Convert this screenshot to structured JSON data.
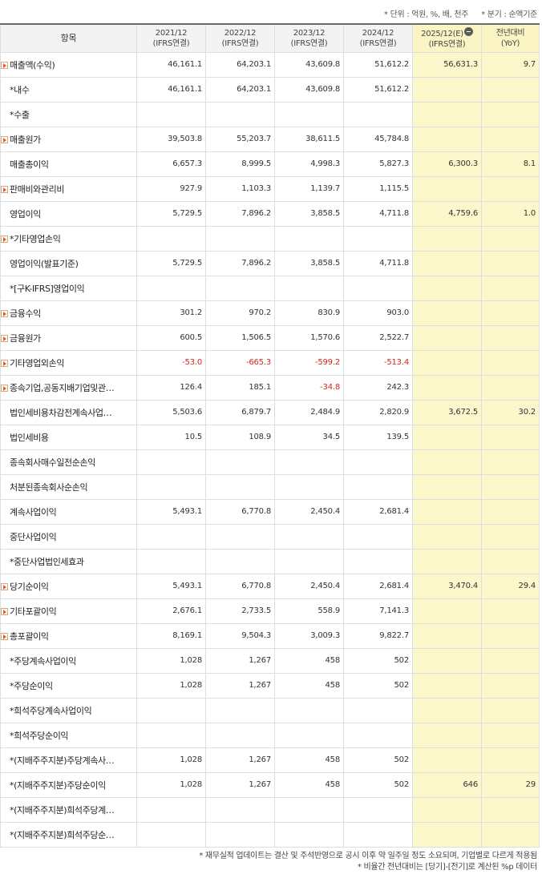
{
  "top_note": {
    "unit": "* 단위 : 억원, %, 배, 천주",
    "period": "* 분기 : 순액기준"
  },
  "headers": {
    "item": "항목",
    "columns": [
      {
        "year": "2021/12",
        "basis": "(IFRS연결)"
      },
      {
        "year": "2022/12",
        "basis": "(IFRS연결)"
      },
      {
        "year": "2023/12",
        "basis": "(IFRS연결)"
      },
      {
        "year": "2024/12",
        "basis": "(IFRS연결)"
      },
      {
        "year": "2025/12(E)",
        "basis": "(IFRS연결)"
      },
      {
        "year": "전년대비",
        "basis": "(YoY)"
      }
    ]
  },
  "rows": [
    {
      "label": "매출액(수익)",
      "expand": true,
      "values": [
        "46,161.1",
        "64,203.1",
        "43,609.8",
        "51,612.2",
        "56,631.3",
        "9.7"
      ]
    },
    {
      "label": "*내수",
      "expand": false,
      "values": [
        "46,161.1",
        "64,203.1",
        "43,609.8",
        "51,612.2",
        "",
        ""
      ]
    },
    {
      "label": "*수출",
      "expand": false,
      "values": [
        "",
        "",
        "",
        "",
        "",
        ""
      ]
    },
    {
      "label": "매출원가",
      "expand": true,
      "values": [
        "39,503.8",
        "55,203.7",
        "38,611.5",
        "45,784.8",
        "",
        ""
      ]
    },
    {
      "label": "매출총이익",
      "expand": false,
      "values": [
        "6,657.3",
        "8,999.5",
        "4,998.3",
        "5,827.3",
        "6,300.3",
        "8.1"
      ]
    },
    {
      "label": "판매비와관리비",
      "expand": true,
      "values": [
        "927.9",
        "1,103.3",
        "1,139.7",
        "1,115.5",
        "",
        ""
      ]
    },
    {
      "label": "영업이익",
      "expand": false,
      "values": [
        "5,729.5",
        "7,896.2",
        "3,858.5",
        "4,711.8",
        "4,759.6",
        "1.0"
      ]
    },
    {
      "label": "*기타영업손익",
      "expand": true,
      "values": [
        "",
        "",
        "",
        "",
        "",
        ""
      ]
    },
    {
      "label": "영업이익(발표기준)",
      "expand": false,
      "values": [
        "5,729.5",
        "7,896.2",
        "3,858.5",
        "4,711.8",
        "",
        ""
      ]
    },
    {
      "label": "*[구K-IFRS]영업이익",
      "expand": false,
      "values": [
        "",
        "",
        "",
        "",
        "",
        ""
      ]
    },
    {
      "label": "금융수익",
      "expand": true,
      "values": [
        "301.2",
        "970.2",
        "830.9",
        "903.0",
        "",
        ""
      ]
    },
    {
      "label": "금융원가",
      "expand": true,
      "values": [
        "600.5",
        "1,506.5",
        "1,570.6",
        "2,522.7",
        "",
        ""
      ]
    },
    {
      "label": "기타영업외손익",
      "expand": true,
      "values": [
        "-53.0",
        "-665.3",
        "-599.2",
        "-513.4",
        "",
        ""
      ]
    },
    {
      "label": "종속기업,공동지배기업및관…",
      "expand": true,
      "values": [
        "126.4",
        "185.1",
        "-34.8",
        "242.3",
        "",
        ""
      ]
    },
    {
      "label": "법인세비용차감전계속사업…",
      "expand": false,
      "values": [
        "5,503.6",
        "6,879.7",
        "2,484.9",
        "2,820.9",
        "3,672.5",
        "30.2"
      ]
    },
    {
      "label": "법인세비용",
      "expand": false,
      "values": [
        "10.5",
        "108.9",
        "34.5",
        "139.5",
        "",
        ""
      ]
    },
    {
      "label": "종속회사매수일전순손익",
      "expand": false,
      "values": [
        "",
        "",
        "",
        "",
        "",
        ""
      ]
    },
    {
      "label": "처분된종속회사순손익",
      "expand": false,
      "values": [
        "",
        "",
        "",
        "",
        "",
        ""
      ]
    },
    {
      "label": "계속사업이익",
      "expand": false,
      "values": [
        "5,493.1",
        "6,770.8",
        "2,450.4",
        "2,681.4",
        "",
        ""
      ]
    },
    {
      "label": "중단사업이익",
      "expand": false,
      "values": [
        "",
        "",
        "",
        "",
        "",
        ""
      ]
    },
    {
      "label": "*중단사업법인세효과",
      "expand": false,
      "values": [
        "",
        "",
        "",
        "",
        "",
        ""
      ]
    },
    {
      "label": "당기순이익",
      "expand": true,
      "values": [
        "5,493.1",
        "6,770.8",
        "2,450.4",
        "2,681.4",
        "3,470.4",
        "29.4"
      ]
    },
    {
      "label": "기타포괄이익",
      "expand": true,
      "values": [
        "2,676.1",
        "2,733.5",
        "558.9",
        "7,141.3",
        "",
        ""
      ]
    },
    {
      "label": "총포괄이익",
      "expand": true,
      "values": [
        "8,169.1",
        "9,504.3",
        "3,009.3",
        "9,822.7",
        "",
        ""
      ]
    },
    {
      "label": "*주당계속사업이익",
      "expand": false,
      "values": [
        "1,028",
        "1,267",
        "458",
        "502",
        "",
        ""
      ]
    },
    {
      "label": "*주당순이익",
      "expand": false,
      "values": [
        "1,028",
        "1,267",
        "458",
        "502",
        "",
        ""
      ]
    },
    {
      "label": "*희석주당계속사업이익",
      "expand": false,
      "values": [
        "",
        "",
        "",
        "",
        "",
        ""
      ]
    },
    {
      "label": "*희석주당순이익",
      "expand": false,
      "values": [
        "",
        "",
        "",
        "",
        "",
        ""
      ]
    },
    {
      "label": "*(지배주주지분)주당계속사…",
      "expand": false,
      "values": [
        "1,028",
        "1,267",
        "458",
        "502",
        "",
        ""
      ]
    },
    {
      "label": "*(지배주주지분)주당순이익",
      "expand": false,
      "values": [
        "1,028",
        "1,267",
        "458",
        "502",
        "646",
        "29"
      ]
    },
    {
      "label": "*(지배주주지분)희석주당계…",
      "expand": false,
      "values": [
        "",
        "",
        "",
        "",
        "",
        ""
      ]
    },
    {
      "label": "*(지배주주지분)희석주당순…",
      "expand": false,
      "values": [
        "",
        "",
        "",
        "",
        "",
        ""
      ]
    }
  ],
  "footnotes": [
    "* 재무실적 업데이트는 결산 및 주석반영으로 공시 이후 약 일주일 정도 소요되며, 기업별로 다르게 적용됨",
    "* 비율간 전년대비는 [당기]-[전기]로 계산된 %p 데이터"
  ],
  "colors": {
    "estimate_bg": "#fdf7cc",
    "negative_text": "#d4251c",
    "expand_arrow": "#e8591a",
    "header_border": "#6b6b6b"
  },
  "icons": {
    "expand": "expand-arrow-icon",
    "collapse": "minus-circle-icon"
  }
}
